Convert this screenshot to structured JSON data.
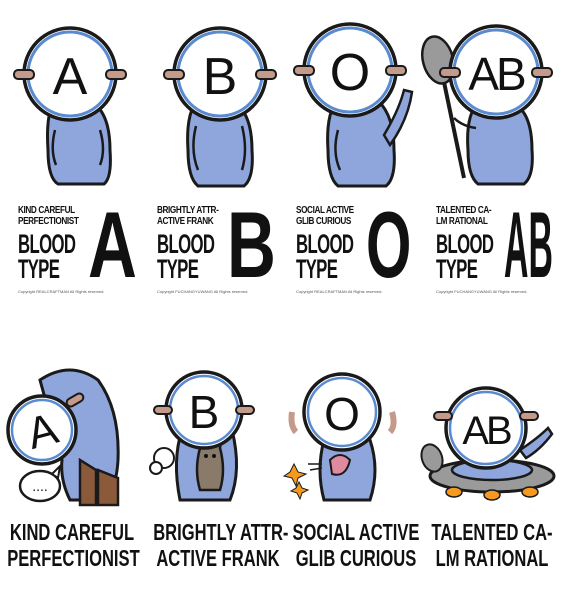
{
  "top_panels": [
    {
      "letter": "A",
      "line1": "KIND CAREFUL",
      "line2": "PERFECTIONIST",
      "blood": "BLOOD",
      "type": "TYPE",
      "giant": "A",
      "copyright": "Copyright  REALCRAFTMAN  All Rights reserved."
    },
    {
      "letter": "B",
      "line1": "BRIGHTLY ATTR-",
      "line2": "ACTIVE FRANK",
      "blood": "BLOOD",
      "type": "TYPE",
      "giant": "B",
      "copyright": "Copyright  FUCHANGYUWANG  All Rights reserved."
    },
    {
      "letter": "O",
      "line1": "SOCIAL ACTIVE",
      "line2": "GLIB CURIOUS",
      "blood": "BLOOD",
      "type": "TYPE",
      "giant": "O",
      "copyright": "Copyright  REALCRAFTMAN  All Rights reserved."
    },
    {
      "letter": "AB",
      "line1": "TALENTED CA-",
      "line2": "LM RATIONAL",
      "blood": "BLOOD",
      "type": "TYPE",
      "giant": "AB",
      "copyright": "Copyright  FUCHANGYUWANG  All Rights reserved."
    }
  ],
  "bottom_panels": [
    {
      "letter": "A",
      "speech": "....",
      "caption1": "KIND CAREFUL",
      "caption2": "PERFECTIONIST"
    },
    {
      "letter": "B",
      "caption1": "BRIGHTLY ATTR-",
      "caption2": "ACTIVE FRANK"
    },
    {
      "letter": "O",
      "caption1": "SOCIAL ACTIVE",
      "caption2": "GLIB CURIOUS"
    },
    {
      "letter": "AB",
      "caption1": "TALENTED CA-",
      "caption2": "LM RATIONAL"
    }
  ],
  "colors": {
    "body": "#8fa6dd",
    "outline": "#1a1a1a",
    "ring": "#5a8ad0",
    "clip": "#c49a8a",
    "orange": "#f59a1e",
    "cat": "#8a7a6a",
    "boot": "#8a5a3a"
  }
}
